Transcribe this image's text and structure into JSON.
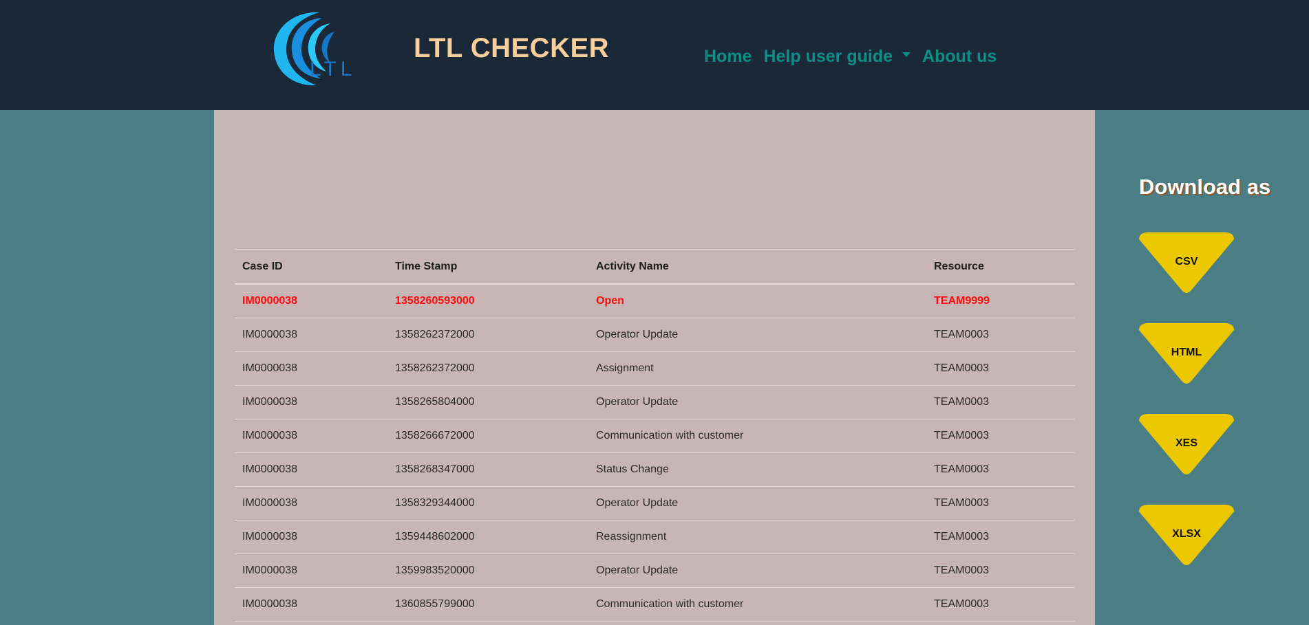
{
  "header": {
    "brand": "LTL CHECKER",
    "logo_text": "LTL",
    "nav": {
      "home": "Home",
      "help": "Help user guide",
      "about": "About us"
    }
  },
  "table": {
    "headers": [
      "Case ID",
      "Time Stamp",
      "Activity Name",
      "Resource"
    ],
    "rows": [
      [
        "IM0000038",
        "1358260593000",
        "Open",
        "TEAM9999"
      ],
      [
        "IM0000038",
        "1358262372000",
        "Operator Update",
        "TEAM0003"
      ],
      [
        "IM0000038",
        "1358262372000",
        "Assignment",
        "TEAM0003"
      ],
      [
        "IM0000038",
        "1358265804000",
        "Operator Update",
        "TEAM0003"
      ],
      [
        "IM0000038",
        "1358266672000",
        "Communication with customer",
        "TEAM0003"
      ],
      [
        "IM0000038",
        "1358268347000",
        "Status Change",
        "TEAM0003"
      ],
      [
        "IM0000038",
        "1358329344000",
        "Operator Update",
        "TEAM0003"
      ],
      [
        "IM0000038",
        "1359448602000",
        "Reassignment",
        "TEAM0003"
      ],
      [
        "IM0000038",
        "1359983520000",
        "Operator Update",
        "TEAM0003"
      ],
      [
        "IM0000038",
        "1360855799000",
        "Communication with customer",
        "TEAM0003"
      ]
    ]
  },
  "download": {
    "title": "Download as",
    "buttons": [
      "CSV",
      "HTML",
      "XES",
      "XLSX"
    ]
  },
  "colors": {
    "header_bg": "#1b2838",
    "page_bg": "#4a7d84",
    "panel_bg": "#c8b6b6",
    "brand": "#f6cf9c",
    "nav": "#0e8f86",
    "highlight_row": "#ff0a0a",
    "button": "#ecc800"
  }
}
